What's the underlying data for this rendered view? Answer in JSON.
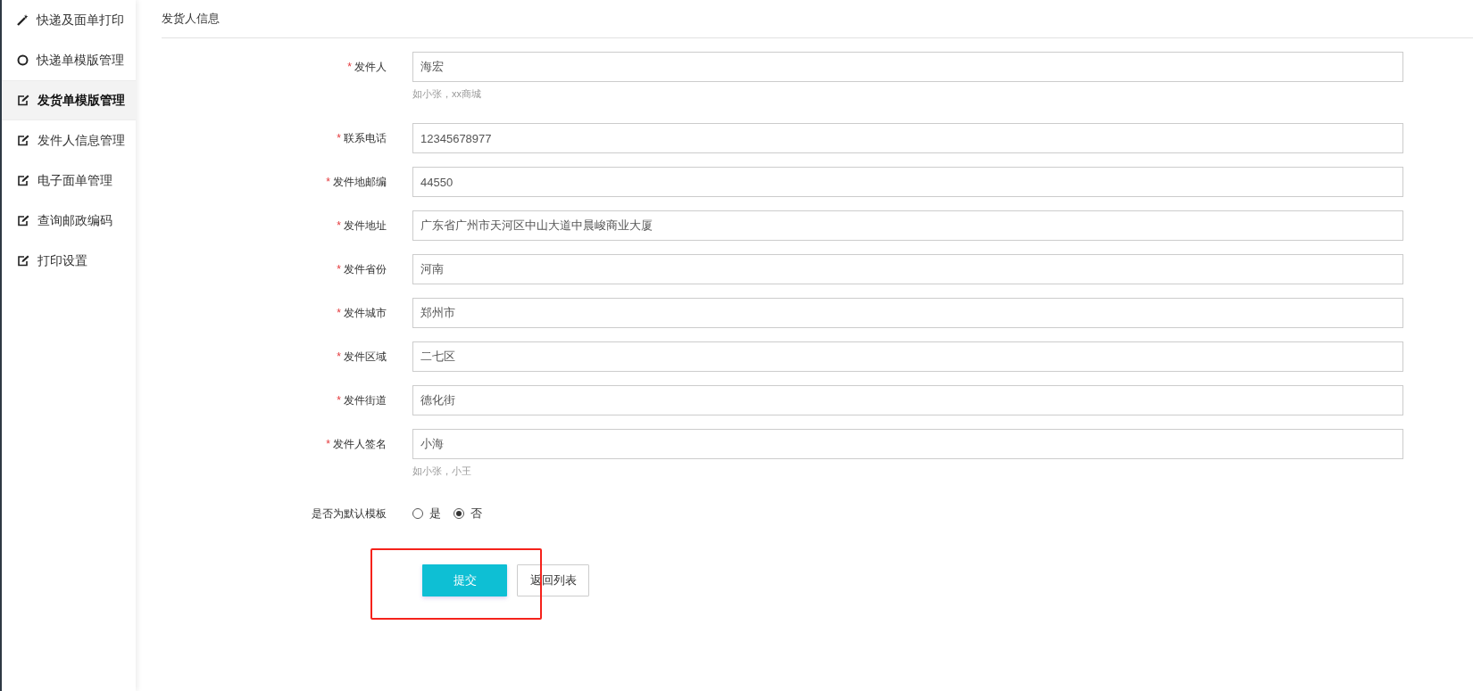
{
  "sidebar": {
    "items": [
      {
        "label": "快递及面单打印",
        "kind": "wand",
        "selected": false
      },
      {
        "label": "快递单模版管理",
        "kind": "circle",
        "selected": false
      },
      {
        "label": "发货单模版管理",
        "kind": "edit",
        "selected": true
      },
      {
        "label": "发件人信息管理",
        "kind": "edit",
        "selected": false
      },
      {
        "label": "电子面单管理",
        "kind": "edit",
        "selected": false
      },
      {
        "label": "查询邮政编码",
        "kind": "edit",
        "selected": false
      },
      {
        "label": "打印设置",
        "kind": "edit",
        "selected": false
      }
    ]
  },
  "section_title": "发货人信息",
  "form": {
    "fields": [
      {
        "required_mark": "*",
        "label": "发件人",
        "value": "海宏",
        "hint": "如小张，xx商城"
      },
      {
        "required_mark": "*",
        "label": "联系电话",
        "value": "12345678977"
      },
      {
        "required_mark": "*",
        "label": "发件地邮编",
        "value": "44550"
      },
      {
        "required_mark": "*",
        "label": "发件地址",
        "value": "广东省广州市天河区中山大道中晨峻商业大厦"
      },
      {
        "required_mark": "*",
        "label": "发件省份",
        "value": "河南"
      },
      {
        "required_mark": "*",
        "label": "发件城市",
        "value": "郑州市"
      },
      {
        "required_mark": "*",
        "label": "发件区域",
        "value": "二七区"
      },
      {
        "required_mark": "*",
        "label": "发件街道",
        "value": "德化街"
      },
      {
        "required_mark": "*",
        "label": "发件人签名",
        "value": "小海",
        "hint": "如小张，小王"
      }
    ],
    "default_template": {
      "label": "是否为默认模板",
      "options": [
        {
          "label": "是",
          "selected": false
        },
        {
          "label": "否",
          "selected": true
        }
      ]
    },
    "buttons": [
      {
        "label": "提交",
        "kind": "primary"
      },
      {
        "label": "返回列表",
        "kind": "default"
      }
    ]
  }
}
